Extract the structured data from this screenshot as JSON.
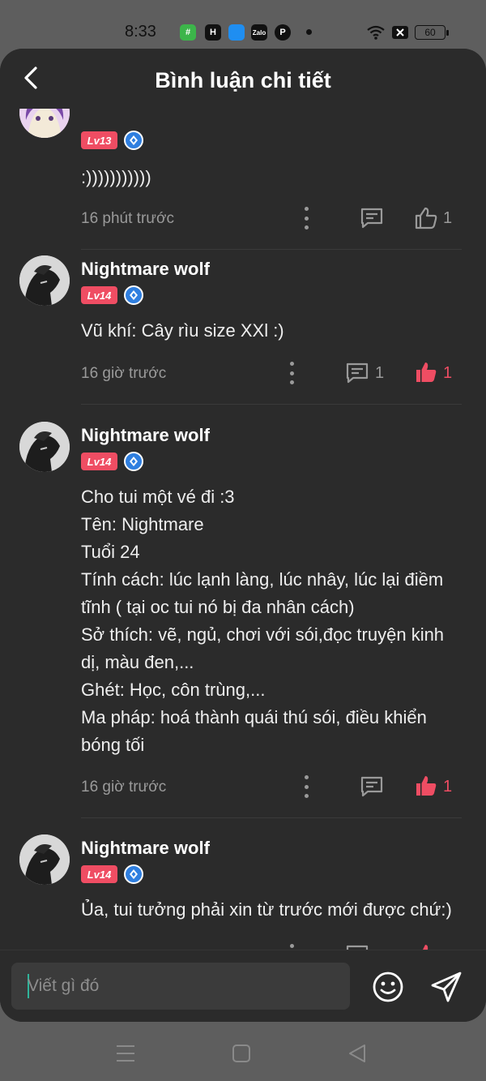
{
  "status_bar": {
    "time": "8:33",
    "app_icons": [
      "#",
      "H",
      "",
      "Zalo",
      "P"
    ],
    "battery": "60"
  },
  "header": {
    "title": "Bình luận chi tiết"
  },
  "comments": [
    {
      "level": "Lv13",
      "text": ":)))))))))))",
      "time": "16 phút trước",
      "replies": "",
      "likes": "1",
      "liked": false
    },
    {
      "name": "Nightmare wolf",
      "level": "Lv14",
      "text": "Vũ khí: Cây rìu size XXl :)",
      "time": "16 giờ trước",
      "replies": "1",
      "likes": "1",
      "liked": true
    },
    {
      "name": "Nightmare wolf",
      "level": "Lv14",
      "text_lines": [
        "Cho tui một vé đi :3",
        "Tên: Nightmare",
        "Tuổi 24",
        "Tính cách: lúc lạnh làng, lúc nhây, lúc lại điềm",
        "tĩnh ( tại oc tui nó bị đa nhân cách)",
        "Sở thích: vẽ, ngủ, chơi với sói,đọc truyện kinh",
        "dị, màu đen,...",
        "Ghét: Học, côn trùng,...",
        "Ma pháp: hoá thành quái thú sói, điều khiển",
        "bóng tối"
      ],
      "time": "16 giờ trước",
      "replies": "",
      "likes": "1",
      "liked": true
    },
    {
      "name": "Nightmare wolf",
      "level": "Lv14",
      "text": "Ủa, tui tưởng phải xin từ trước mới được chứ:)",
      "time": "",
      "replies": "",
      "likes": "",
      "liked": true
    }
  ],
  "input": {
    "placeholder": "Viết gì đó"
  },
  "icons": {
    "back": "chevron-left-icon",
    "more": "more-vertical-icon",
    "reply": "comment-icon",
    "like": "thumbs-up-icon",
    "emoji": "smiley-icon",
    "send": "send-icon",
    "nav_menu": "menu-icon",
    "nav_home": "square-icon",
    "nav_back": "triangle-back-icon"
  },
  "colors": {
    "panel_bg": "#2b2b2b",
    "accent_red": "#ef4d63",
    "vip_blue": "#2f7fe0",
    "muted_text": "#9a9a9a"
  }
}
